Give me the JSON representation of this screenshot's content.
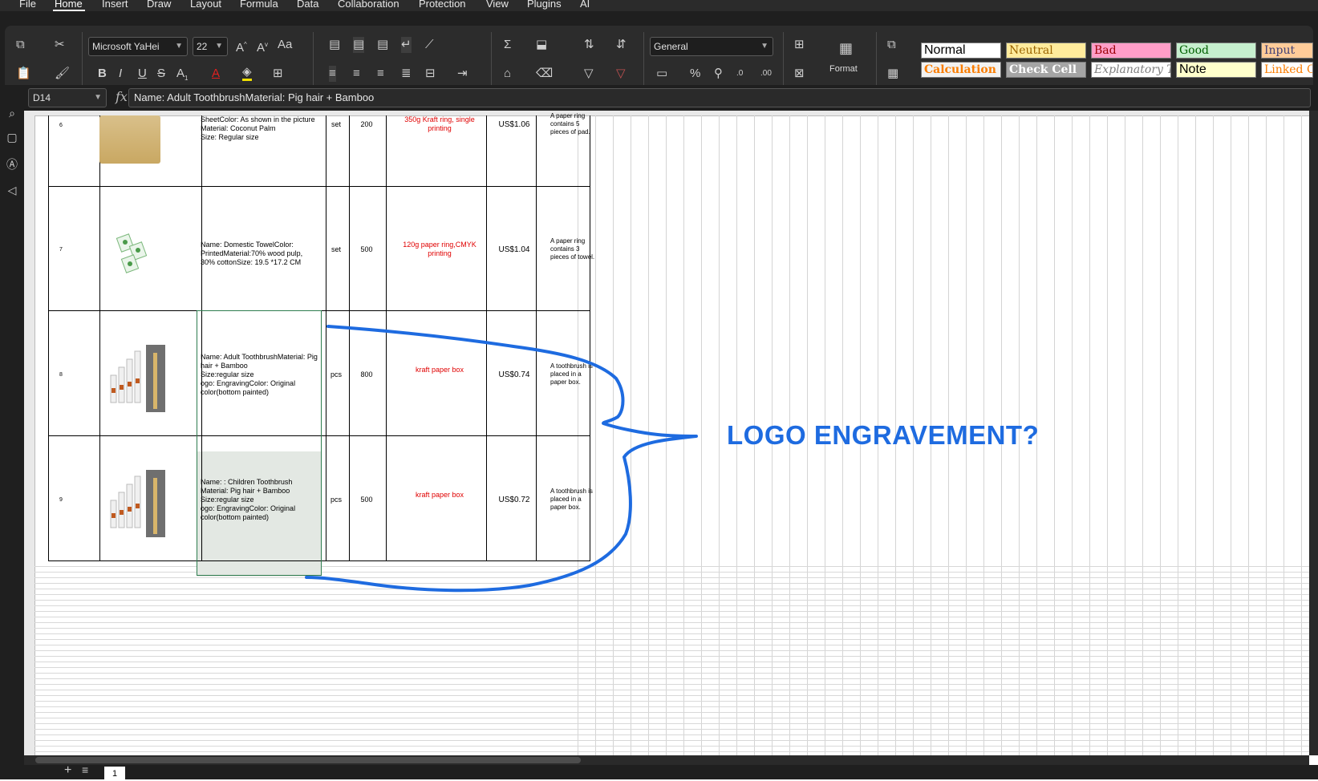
{
  "menu": {
    "items": [
      "File",
      "Home",
      "Insert",
      "Draw",
      "Layout",
      "Formula",
      "Data",
      "Collaboration",
      "Protection",
      "View",
      "Plugins",
      "AI"
    ],
    "active": "Home"
  },
  "ribbon": {
    "font_name": "Microsoft YaHei",
    "font_size": "22",
    "number_format": "General",
    "format_label": "Format",
    "styles": [
      "Normal",
      "Neutral",
      "Bad",
      "Good",
      "Input",
      "Calculation",
      "Check Cell",
      "Explanatory Te",
      "Note",
      "Linked Cel"
    ],
    "style_colors": {
      "normal_bg": "#ffffff",
      "neutral_bg": "#ffeb9c",
      "bad_bg": "#ff9ec8",
      "good_bg": "#c6efce",
      "input_bg": "#ffcc99",
      "calc_bg": "#f2f2f2",
      "check_bg": "#a5a5a5",
      "expl_bg": "#ffffff",
      "note_bg": "#ffffcc",
      "linked_bg": "#ffffff"
    }
  },
  "formula_bar": {
    "cell_ref": "D14",
    "content": "Name: Adult ToothbrushMaterial: Pig hair + Bamboo"
  },
  "rows": [
    {
      "no": "6",
      "desc": [
        "SheetColor: As shown in the picture",
        "Material: Coconut Palm",
        "Size: Regular size"
      ],
      "unit": "set",
      "qty": "200",
      "packing": "350g Kraft ring, single printing",
      "price": "US$1.06",
      "remark": "A paper ring contains 5 pieces of pad."
    },
    {
      "no": "7",
      "desc": [
        "Name: Domestic TowelColor:",
        "PrintedMaterial:70% wood pulp,",
        "30% cottonSize: 19.5 *17.2 CM"
      ],
      "unit": "set",
      "qty": "500",
      "packing": "120g paper ring,CMYK printing",
      "price": "US$1.04",
      "remark": "A paper ring contains 3 pieces of towel."
    },
    {
      "no": "8",
      "desc": [
        "Name: Adult ToothbrushMaterial: Pig",
        "hair + Bamboo",
        "Size:regular size",
        "ogo: EngravingColor: Original",
        "color(bottom painted)"
      ],
      "unit": "pcs",
      "qty": "800",
      "packing": "kraft paper box",
      "price": "US$0.74",
      "remark": "A toothbrush is placed in a paper box."
    },
    {
      "no": "9",
      "desc": [
        "Name: : Children Toothbrush",
        "Material: Pig hair + Bamboo",
        "Size:regular size",
        "ogo: EngravingColor: Original",
        "color(bottom painted)"
      ],
      "unit": "pcs",
      "qty": "500",
      "packing": "kraft paper box",
      "price": "US$0.72",
      "remark": "A toothbrush is placed in a paper box."
    }
  ],
  "annotation": {
    "text": "LOGO ENGRAVEMENT?",
    "color": "#1e6be0"
  },
  "sheet": {
    "tab": "1"
  }
}
